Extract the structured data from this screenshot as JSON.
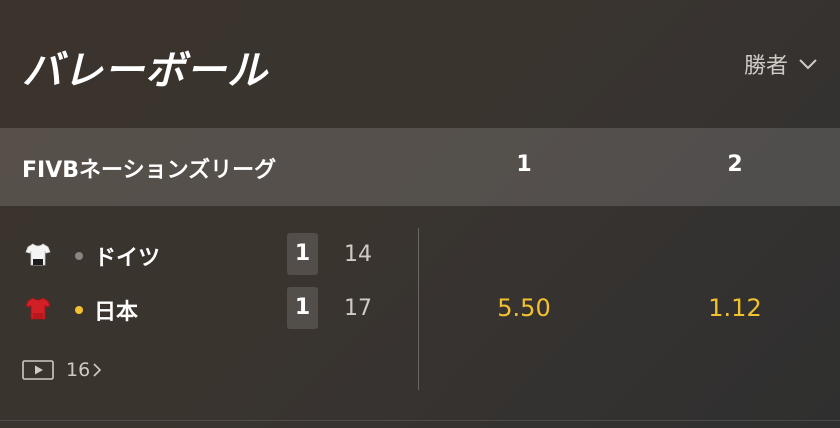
{
  "header": {
    "sport_title": "バレーボール",
    "market_label": "勝者"
  },
  "league": {
    "name": "FIVBネーションズリーグ",
    "col_1": "1",
    "col_2": "2"
  },
  "match": {
    "home": {
      "name": "ドイツ",
      "sets": "1",
      "points": "14",
      "serve_dot_color": "#8a8580",
      "jersey_icon": "jersey-white-icon"
    },
    "away": {
      "name": "日本",
      "sets": "1",
      "points": "17",
      "serve_dot_color": "#f3c12f",
      "jersey_icon": "jersey-red-icon"
    },
    "odds_1": "5.50",
    "odds_2": "1.12",
    "more_markets": "16"
  },
  "colors": {
    "accent_odds": "#f3c12f",
    "muted_text": "#cfcac4"
  }
}
